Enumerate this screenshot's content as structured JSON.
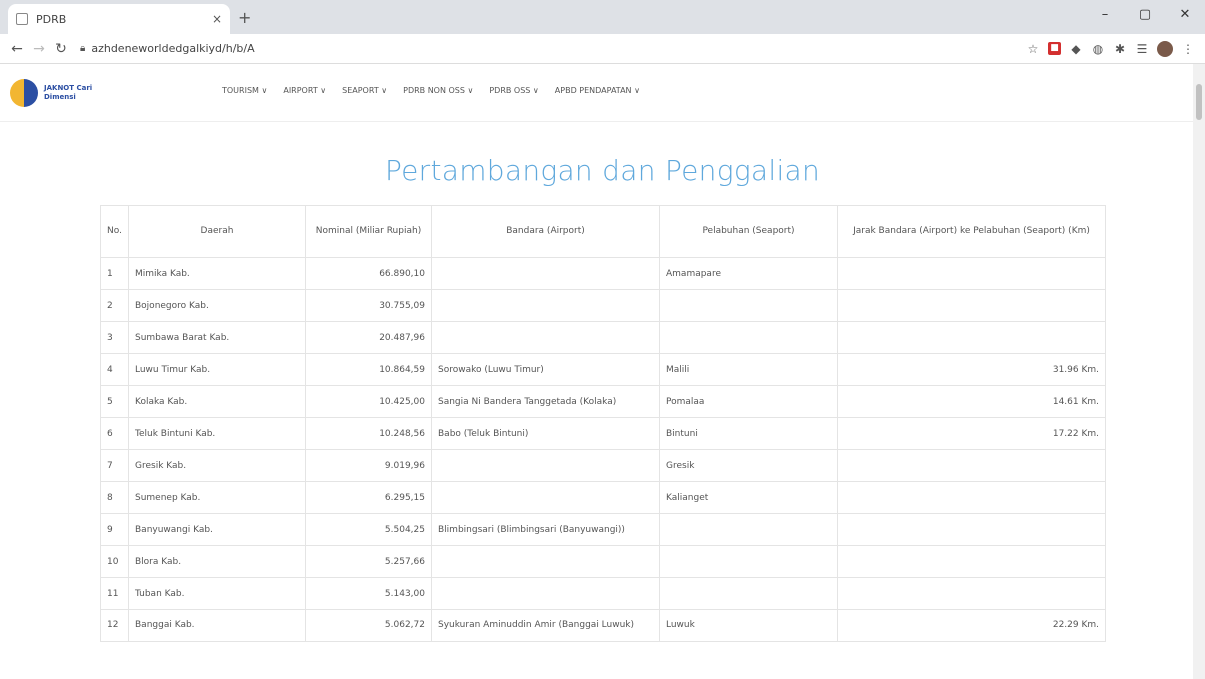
{
  "browser": {
    "tab_title": "PDRB",
    "tab_close": "×",
    "new_tab": "+",
    "url": "azhdeneworldedgalkiyd/h/b/A",
    "win_min": "–",
    "win_max": "▢",
    "win_close": "✕"
  },
  "site": {
    "logo_text": "JAKNOT Cari Dimensi",
    "menu": [
      "TOURISM ∨",
      "AIRPORT ∨",
      "SEAPORT ∨",
      "PDRB NON OSS ∨",
      "PDRB OSS ∨",
      "APBD PENDAPATAN ∨"
    ]
  },
  "page": {
    "title": "Pertambangan dan Penggalian"
  },
  "table": {
    "headers": {
      "no": "No.",
      "daerah": "Daerah",
      "nominal": "Nominal (Miliar Rupiah)",
      "bandara": "Bandara (Airport)",
      "pelabuhan": "Pelabuhan (Seaport)",
      "jarak": "Jarak Bandara (Airport) ke Pelabuhan (Seaport) (Km)"
    },
    "rows": [
      {
        "no": "1",
        "daerah": "Mimika Kab.",
        "nominal": "66.890,10",
        "bandara": "",
        "pelabuhan": "Amamapare",
        "jarak": ""
      },
      {
        "no": "2",
        "daerah": "Bojonegoro Kab.",
        "nominal": "30.755,09",
        "bandara": "",
        "pelabuhan": "",
        "jarak": ""
      },
      {
        "no": "3",
        "daerah": "Sumbawa Barat Kab.",
        "nominal": "20.487,96",
        "bandara": "",
        "pelabuhan": "",
        "jarak": ""
      },
      {
        "no": "4",
        "daerah": "Luwu Timur Kab.",
        "nominal": "10.864,59",
        "bandara": "Sorowako (Luwu Timur)",
        "pelabuhan": "Malili",
        "jarak": "31.96 Km."
      },
      {
        "no": "5",
        "daerah": "Kolaka Kab.",
        "nominal": "10.425,00",
        "bandara": "Sangia Ni Bandera Tanggetada (Kolaka)",
        "pelabuhan": "Pomalaa",
        "jarak": "14.61 Km."
      },
      {
        "no": "6",
        "daerah": "Teluk Bintuni Kab.",
        "nominal": "10.248,56",
        "bandara": "Babo (Teluk Bintuni)",
        "pelabuhan": "Bintuni",
        "jarak": "17.22 Km."
      },
      {
        "no": "7",
        "daerah": "Gresik Kab.",
        "nominal": "9.019,96",
        "bandara": "",
        "pelabuhan": "Gresik",
        "jarak": ""
      },
      {
        "no": "8",
        "daerah": "Sumenep Kab.",
        "nominal": "6.295,15",
        "bandara": "",
        "pelabuhan": "Kalianget",
        "jarak": ""
      },
      {
        "no": "9",
        "daerah": "Banyuwangi Kab.",
        "nominal": "5.504,25",
        "bandara": "Blimbingsari (Blimbingsari (Banyuwangi))",
        "pelabuhan": "",
        "jarak": ""
      },
      {
        "no": "10",
        "daerah": "Blora Kab.",
        "nominal": "5.257,66",
        "bandara": "",
        "pelabuhan": "",
        "jarak": ""
      },
      {
        "no": "11",
        "daerah": "Tuban Kab.",
        "nominal": "5.143,00",
        "bandara": "",
        "pelabuhan": "",
        "jarak": ""
      },
      {
        "no": "12",
        "daerah": "Banggai Kab.",
        "nominal": "5.062,72",
        "bandara": "Syukuran Aminuddin Amir (Banggai Luwuk)",
        "pelabuhan": "Luwuk",
        "jarak": "22.29 Km."
      }
    ]
  }
}
